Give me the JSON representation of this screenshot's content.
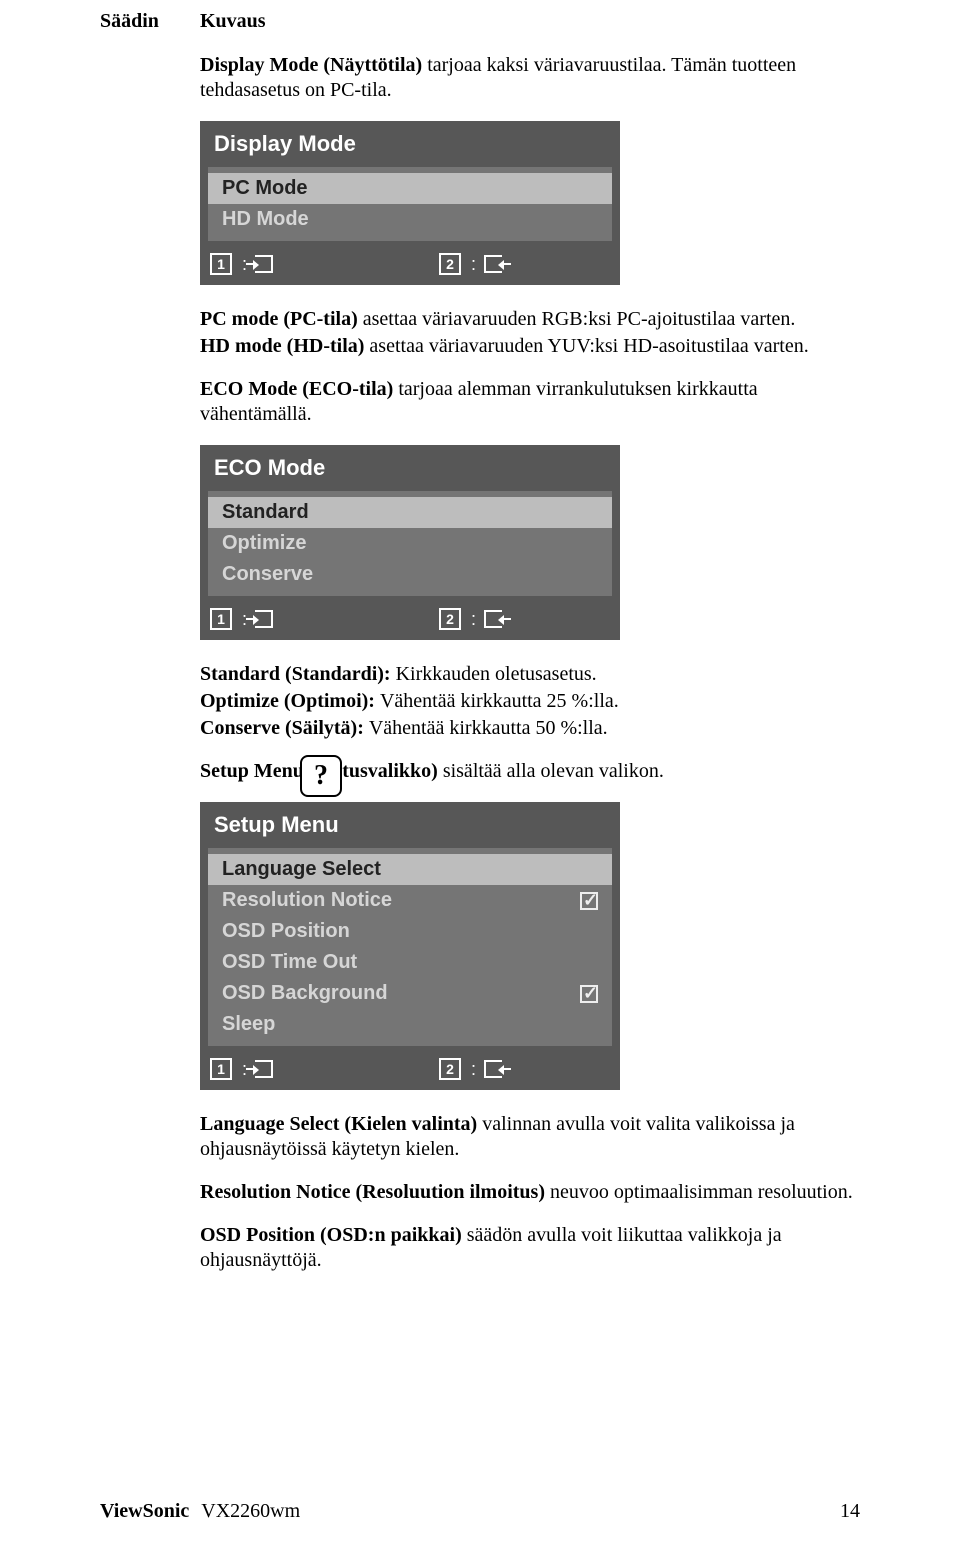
{
  "header": {
    "col1": "Säädin",
    "col2": "Kuvaus"
  },
  "p1": {
    "bold": "Display Mode (Näyttötila) ",
    "rest": "tarjoaa kaksi väriavaruustilaa. Tämän tuotteen tehdasasetus on PC-tila."
  },
  "display_mode_menu": {
    "title": "Display Mode",
    "items": [
      "PC Mode",
      "HD Mode"
    ],
    "selected_index": 0,
    "key1": "1",
    "key2": "2"
  },
  "p2a": {
    "bold": "PC mode (PC-tila) ",
    "rest": "asettaa väriavaruuden RGB:ksi PC-ajoitustilaa varten."
  },
  "p2b": {
    "bold": "HD mode (HD-tila) ",
    "rest": "asettaa väriavaruuden YUV:ksi HD-asoitustilaa varten."
  },
  "p3": {
    "bold": "ECO Mode (ECO-tila) ",
    "rest": "tarjoaa alemman virrankulutuksen kirkkautta vähentämällä."
  },
  "eco_mode_menu": {
    "title": "ECO Mode",
    "items": [
      "Standard",
      "Optimize",
      "Conserve"
    ],
    "selected_index": 0,
    "key1": "1",
    "key2": "2"
  },
  "p4a": {
    "bold": "Standard (Standardi): ",
    "rest": "Kirkkauden oletusasetus."
  },
  "p4b": {
    "bold": "Optimize (Optimoi): ",
    "rest": "Vähentää kirkkautta 25 %:lla."
  },
  "p4c": {
    "bold": "Conserve (Säilytä): ",
    "rest": "Vähentää kirkkautta 50 %:lla."
  },
  "qmark": "?",
  "p5": {
    "bold": "Setup Menu (asetusvalikko) ",
    "rest": "sisältää alla olevan valikon."
  },
  "setup_menu": {
    "title": "Setup Menu",
    "items": [
      {
        "label": "Language Select",
        "checkbox": null
      },
      {
        "label": "Resolution Notice",
        "checkbox": true
      },
      {
        "label": "OSD Position",
        "checkbox": null
      },
      {
        "label": "OSD Time Out",
        "checkbox": null
      },
      {
        "label": "OSD Background",
        "checkbox": true
      },
      {
        "label": "Sleep",
        "checkbox": null
      }
    ],
    "selected_index": 0,
    "key1": "1",
    "key2": "2"
  },
  "p6": {
    "bold": "Language Select (Kielen valinta) ",
    "rest": "valinnan avulla voit valita valikoissa ja ohjausnäytöissä käytetyn kielen."
  },
  "p7": {
    "bold": "Resolution Notice (Resoluution ilmoitus) ",
    "rest": " neuvoo optimaalisimman resoluution."
  },
  "p8": {
    "bold": "OSD Position (OSD:n paikkai) ",
    "rest": "säädön avulla voit liikuttaa valikkoja ja ohjausnäyttöjä."
  },
  "footer": {
    "brand": "ViewSonic",
    "model": "VX2260wm",
    "page": "14"
  }
}
